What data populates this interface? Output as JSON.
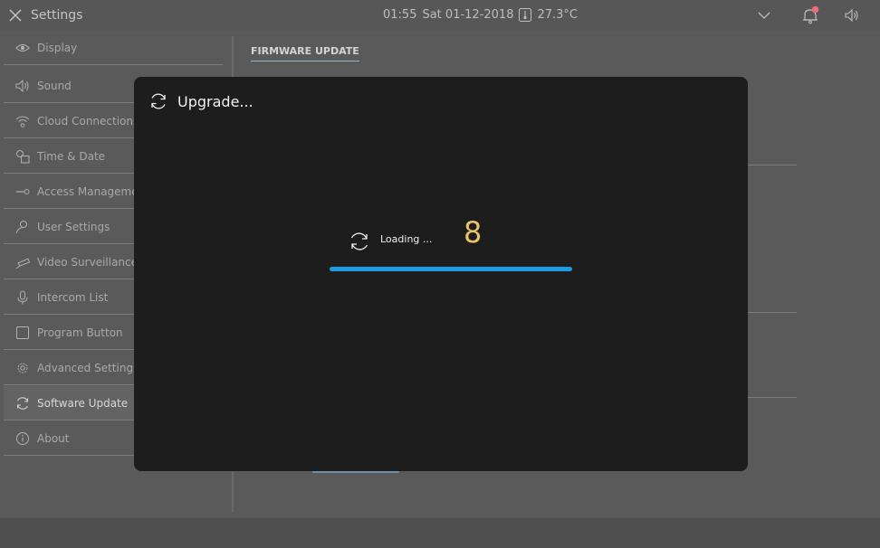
{
  "topbar": {
    "title": "Settings",
    "time": "01:55",
    "date": "Sat 01-12-2018",
    "temperature": "27.3°C",
    "notification_color": "#ef6c7d"
  },
  "sidebar": {
    "items": [
      {
        "label": "Display",
        "icon": "eye-icon"
      },
      {
        "label": "Sound",
        "icon": "speaker-icon"
      },
      {
        "label": "Cloud Connections",
        "icon": "wifi-icon"
      },
      {
        "label": "Time & Date",
        "icon": "clock-calendar-icon"
      },
      {
        "label": "Access Management",
        "icon": "key-icon"
      },
      {
        "label": "User Settings",
        "icon": "user-icon"
      },
      {
        "label": "Video Surveillance",
        "icon": "camera-icon"
      },
      {
        "label": "Intercom List",
        "icon": "microphone-icon"
      },
      {
        "label": "Program Button",
        "icon": "square-icon"
      },
      {
        "label": "Advanced Settings",
        "icon": "gear-icon"
      },
      {
        "label": "Software Update",
        "icon": "refresh-icon",
        "active": true
      },
      {
        "label": "About",
        "icon": "info-icon"
      }
    ]
  },
  "content": {
    "title": "FIRMWARE UPDATE"
  },
  "modal": {
    "title": "Upgrade...",
    "loading_text": "Loading ...",
    "countdown": "8",
    "progress": 1.0,
    "accent_color": "#1b9be0"
  }
}
